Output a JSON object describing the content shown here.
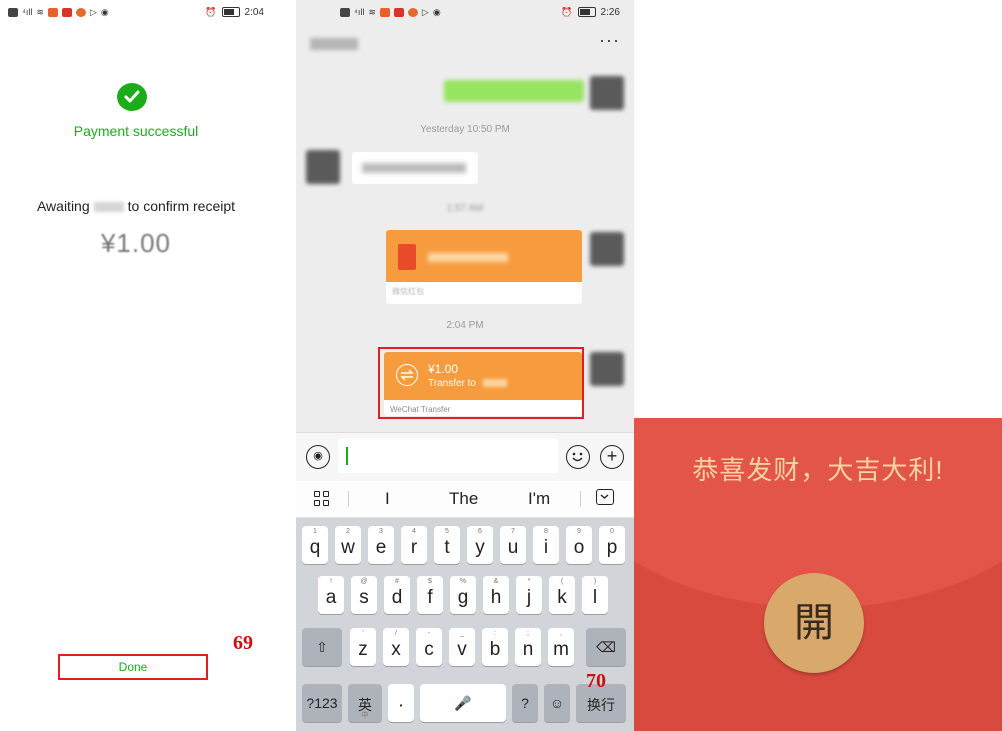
{
  "payment_screen": {
    "status_time": "2:04",
    "title": "Payment successful",
    "awaiting_prefix": "Awaiting",
    "awaiting_suffix": "to confirm receipt",
    "amount": "¥1.00",
    "done_label": "Done",
    "annotation": "69"
  },
  "chat_screen": {
    "status_time": "2:26",
    "more_label": "···",
    "timestamp_1": "Yesterday 10:50 PM",
    "timestamp_2": "1:57 AM",
    "timestamp_3": "2:04 PM",
    "red_packet_footer": "微信红包",
    "transfer_amount": "¥1.00",
    "transfer_to": "Transfer to",
    "transfer_footer": "WeChat Transfer",
    "annotation": "70"
  },
  "keyboard": {
    "suggestions": [
      "I",
      "The",
      "I'm"
    ],
    "row1": [
      {
        "sub": "1",
        "main": "q"
      },
      {
        "sub": "2",
        "main": "w"
      },
      {
        "sub": "3",
        "main": "e"
      },
      {
        "sub": "4",
        "main": "r"
      },
      {
        "sub": "5",
        "main": "t"
      },
      {
        "sub": "6",
        "main": "y"
      },
      {
        "sub": "7",
        "main": "u"
      },
      {
        "sub": "8",
        "main": "i"
      },
      {
        "sub": "9",
        "main": "o"
      },
      {
        "sub": "0",
        "main": "p"
      }
    ],
    "row2": [
      {
        "sub": "!",
        "main": "a"
      },
      {
        "sub": "@",
        "main": "s"
      },
      {
        "sub": "#",
        "main": "d"
      },
      {
        "sub": "$",
        "main": "f"
      },
      {
        "sub": "%",
        "main": "g"
      },
      {
        "sub": "&",
        "main": "h"
      },
      {
        "sub": "*",
        "main": "j"
      },
      {
        "sub": "(",
        "main": "k"
      },
      {
        "sub": ")",
        "main": "l"
      }
    ],
    "row3": [
      {
        "sub": "'",
        "main": "z"
      },
      {
        "sub": "/",
        "main": "x"
      },
      {
        "sub": "-",
        "main": "c"
      },
      {
        "sub": "_",
        "main": "v"
      },
      {
        "sub": ":",
        "main": "b"
      },
      {
        "sub": ";",
        "main": "n"
      },
      {
        "sub": ",",
        "main": "m"
      }
    ],
    "num_key": "?123",
    "lang_key": "英",
    "lang_key_sub": "中",
    "dot_key": "·",
    "question_key": "?",
    "enter_key": "换行"
  },
  "red_packet_open": {
    "greeting": "恭喜发财，大吉大利!",
    "open_label": "開"
  }
}
